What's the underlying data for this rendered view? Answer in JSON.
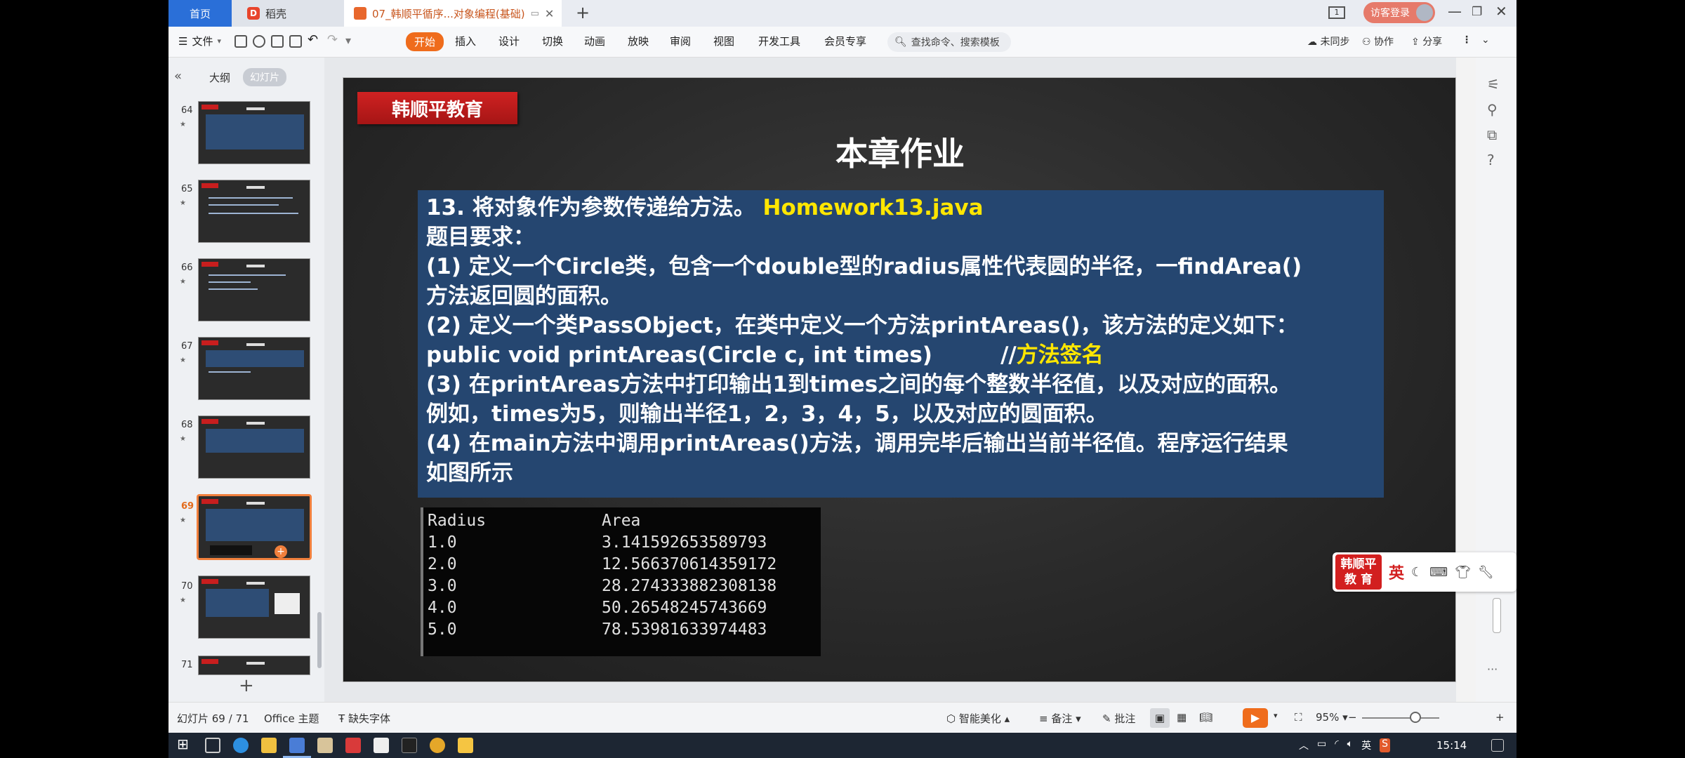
{
  "tabs": {
    "home": "首页",
    "docer": "稻壳",
    "document": "07_韩顺平循序...对象编程(基础)"
  },
  "titlebar": {
    "login": "访客登录",
    "layout_badge": "1"
  },
  "menu": {
    "file": "文件",
    "items": [
      "开始",
      "插入",
      "设计",
      "切换",
      "动画",
      "放映",
      "审阅",
      "视图",
      "开发工具",
      "会员专享"
    ],
    "search_placeholder": "查找命令、搜索模板",
    "sync": "未同步",
    "collab": "协作",
    "share": "分享"
  },
  "left_panel": {
    "outline": "大纲",
    "slides": "幻灯片",
    "thumbnails": [
      "64",
      "65",
      "66",
      "67",
      "68",
      "69",
      "70",
      "71"
    ],
    "selected": "69"
  },
  "slide": {
    "brand": "韩顺平教育",
    "title": "本章作业",
    "line1_a": "13. 将对象作为参数传递给方法。",
    "line1_b": "Homework13.java",
    "line2": "题目要求：",
    "line3": "(1) 定义一个Circle类，包含一个double型的radius属性代表圆的半径，一findArea()",
    "line4": "方法返回圆的面积。",
    "line5": "(2) 定义一个类PassObject，在类中定义一个方法printAreas()，该方法的定义如下：",
    "line6_a": "public void printAreas(Circle c, int times)         //",
    "line6_b": "方法签名",
    "line7": "(3) 在printAreas方法中打印输出1到times之间的每个整数半径值，以及对应的面积。",
    "line8": "例如，times为5，则输出半径1，2，3，4，5，以及对应的圆面积。",
    "line9": "(4) 在main方法中调用printAreas()方法，调用完毕后输出当前半径值。程序运行结果",
    "line10": "如图所示",
    "console": {
      "headers": [
        "Radius",
        "Area"
      ],
      "rows": [
        [
          "1.0",
          "3.141592653589793"
        ],
        [
          "2.0",
          "12.566370614359172"
        ],
        [
          "3.0",
          "28.274333882308138"
        ],
        [
          "4.0",
          "50.26548245743669"
        ],
        [
          "5.0",
          "78.53981633974483"
        ]
      ]
    }
  },
  "ime": {
    "logo_line1": "韩顺平",
    "logo_line2": "教 育",
    "lang": "英"
  },
  "statusbar": {
    "slide_counter": "幻灯片 69 / 71",
    "theme": "Office 主题",
    "missing_font": "缺失字体",
    "beautify": "智能美化",
    "notes": "备注",
    "comments": "批注",
    "zoom": "95%"
  },
  "taskbar": {
    "tray_lang": "英",
    "time": "15:14"
  },
  "colors": {
    "accent_orange": "#ef6c1c",
    "brand_red": "#c81e1e",
    "content_blue": "#254670",
    "highlight_yellow": "#ffe600"
  }
}
